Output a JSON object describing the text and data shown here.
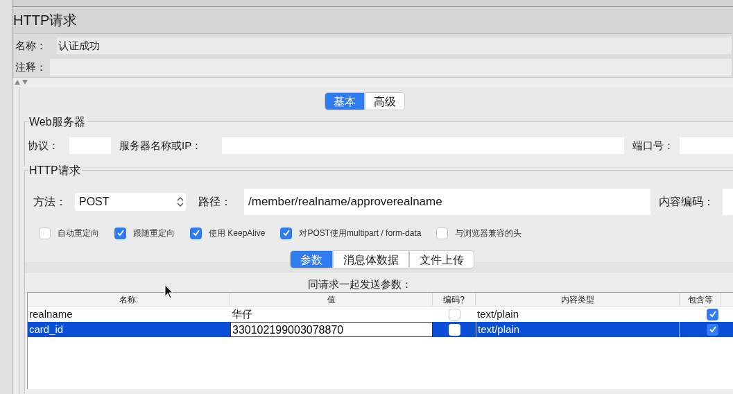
{
  "panel": {
    "title": "HTTP请求"
  },
  "name_field": {
    "label": "名称：",
    "value": "认证成功"
  },
  "comment_field": {
    "label": "注释："
  },
  "tabs": [
    {
      "label": "基本",
      "selected": true
    },
    {
      "label": "高级",
      "selected": false
    }
  ],
  "web_server": {
    "title": "Web服务器",
    "protocol_label": "协议：",
    "server_label": "服务器名称或IP：",
    "port_label": "端口号："
  },
  "http_request": {
    "title": "HTTP请求",
    "method_label": "方法：",
    "method": "POST",
    "path_label": "路径：",
    "path": "/member/realname/approverealname",
    "encoding_label": "内容编码："
  },
  "options": [
    {
      "label": "自动重定向",
      "checked": false
    },
    {
      "label": "跟随重定向",
      "checked": true
    },
    {
      "label": "使用 KeepAlive",
      "checked": true
    },
    {
      "label": "对POST使用multipart / form-data",
      "checked": true
    },
    {
      "label": "与浏览器兼容的头",
      "checked": false
    }
  ],
  "sub_tabs": [
    {
      "label": "参数",
      "selected": true
    },
    {
      "label": "消息体数据",
      "selected": false
    },
    {
      "label": "文件上传",
      "selected": false
    }
  ],
  "params": {
    "caption": "同请求一起发送参数：",
    "columns": [
      "名称:",
      "值",
      "编码?",
      "内容类型",
      "包含等"
    ],
    "rows": [
      {
        "name": "realname",
        "value": "华仔",
        "encode": false,
        "content_type": "text/plain",
        "include_equals": true,
        "selected": false,
        "editing": false
      },
      {
        "name": "card_id",
        "value": "330102199003078870",
        "encode": false,
        "content_type": "text/plain",
        "include_equals": true,
        "selected": true,
        "editing": true
      }
    ]
  }
}
